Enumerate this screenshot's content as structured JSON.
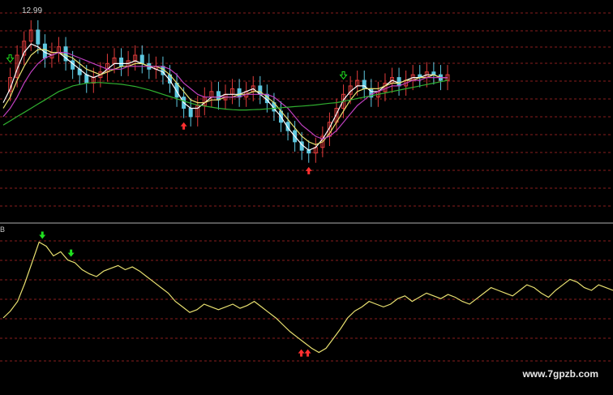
{
  "chart": {
    "price_label": "12.99",
    "sub_indicator_label": "B",
    "watermark": "www.7gpzb.com"
  },
  "colors": {
    "background": "#000000",
    "grid": "#8a1e1e",
    "divider": "#b0b0b0",
    "up_candle": "#e23c3c",
    "down_candle": "#5ec8e0",
    "ma_white": "#ffffff",
    "ma_yellow": "#e8e070",
    "ma_magenta": "#c040c0",
    "ma_green": "#30b030",
    "indicator_line": "#e8e070",
    "buy_arrow": "#ff3030",
    "sell_arrow": "#20e020"
  },
  "chart_data": [
    {
      "type": "candlestick",
      "title": "",
      "ylim": [
        7.0,
        13.5
      ],
      "close": [
        10.4,
        10.9,
        11.7,
        12.2,
        12.6,
        12.1,
        11.6,
        11.8,
        12.0,
        11.5,
        11.2,
        11.0,
        10.7,
        10.9,
        11.1,
        11.4,
        11.6,
        11.3,
        11.5,
        11.7,
        11.4,
        11.2,
        11.3,
        11.0,
        10.7,
        10.2,
        9.8,
        9.5,
        9.9,
        10.2,
        10.4,
        10.1,
        10.3,
        10.5,
        10.2,
        10.4,
        10.6,
        10.3,
        10.0,
        9.7,
        9.3,
        9.0,
        8.6,
        8.3,
        8.2,
        8.4,
        8.8,
        9.3,
        9.8,
        10.3,
        10.6,
        10.8,
        10.5,
        10.2,
        10.4,
        10.7,
        10.9,
        10.6,
        10.8,
        11.0,
        10.9,
        11.1,
        11.0,
        10.8,
        11.0
      ],
      "series": [
        {
          "name": "",
          "values": [
            10.0,
            10.5,
            11.2,
            11.8,
            12.1,
            12.0,
            11.8,
            11.7,
            11.8,
            11.6,
            11.4,
            11.2,
            11.0,
            10.9,
            11.0,
            11.2,
            11.4,
            11.4,
            11.4,
            11.5,
            11.4,
            11.3,
            11.2,
            11.1,
            10.8,
            10.4,
            10.0,
            9.8,
            9.8,
            10.0,
            10.2,
            10.2,
            10.3,
            10.3,
            10.3,
            10.4,
            10.5,
            10.3,
            10.1,
            9.8,
            9.5,
            9.1,
            8.8,
            8.5,
            8.3,
            8.4,
            8.7,
            9.1,
            9.6,
            10.1,
            10.4,
            10.6,
            10.6,
            10.4,
            10.4,
            10.6,
            10.8,
            10.7,
            10.8,
            10.9,
            10.9,
            11.0,
            11.0,
            10.9,
            10.9
          ]
        },
        {
          "name": "",
          "values": [
            9.8,
            10.2,
            10.8,
            11.3,
            11.7,
            11.9,
            11.9,
            11.8,
            11.8,
            11.7,
            11.6,
            11.4,
            11.2,
            11.1,
            11.0,
            11.1,
            11.2,
            11.3,
            11.3,
            11.4,
            11.4,
            11.3,
            11.3,
            11.2,
            11.0,
            10.7,
            10.4,
            10.1,
            10.0,
            10.0,
            10.1,
            10.1,
            10.2,
            10.2,
            10.3,
            10.3,
            10.4,
            10.4,
            10.2,
            10.0,
            9.7,
            9.4,
            9.1,
            8.8,
            8.6,
            8.5,
            8.6,
            8.9,
            9.3,
            9.7,
            10.1,
            10.4,
            10.5,
            10.5,
            10.5,
            10.6,
            10.7,
            10.7,
            10.8,
            10.8,
            10.9,
            10.9,
            11.0,
            10.9,
            10.9
          ]
        },
        {
          "name": "",
          "values": [
            9.5,
            9.8,
            10.2,
            10.7,
            11.1,
            11.4,
            11.6,
            11.7,
            11.8,
            11.8,
            11.7,
            11.6,
            11.5,
            11.4,
            11.3,
            11.2,
            11.2,
            11.2,
            11.3,
            11.3,
            11.3,
            11.3,
            11.3,
            11.3,
            11.2,
            11.0,
            10.7,
            10.5,
            10.3,
            10.2,
            10.2,
            10.2,
            10.2,
            10.2,
            10.2,
            10.3,
            10.3,
            10.3,
            10.3,
            10.2,
            10.0,
            9.8,
            9.5,
            9.2,
            9.0,
            8.8,
            8.7,
            8.8,
            9.0,
            9.3,
            9.6,
            9.9,
            10.1,
            10.3,
            10.4,
            10.5,
            10.6,
            10.6,
            10.7,
            10.8,
            10.8,
            10.9,
            10.9,
            10.9,
            10.9
          ]
        },
        {
          "name": "",
          "values": [
            9.2,
            9.35,
            9.5,
            9.65,
            9.8,
            9.95,
            10.1,
            10.25,
            10.4,
            10.5,
            10.6,
            10.65,
            10.7,
            10.72,
            10.72,
            10.7,
            10.68,
            10.66,
            10.62,
            10.58,
            10.52,
            10.46,
            10.38,
            10.3,
            10.22,
            10.14,
            10.06,
            9.98,
            9.92,
            9.88,
            9.84,
            9.8,
            9.77,
            9.75,
            9.74,
            9.74,
            9.75,
            9.76,
            9.78,
            9.8,
            9.82,
            9.84,
            9.86,
            9.88,
            9.9,
            9.92,
            9.95,
            9.98,
            10.0,
            10.05,
            10.1,
            10.15,
            10.2,
            10.25,
            10.3,
            10.35,
            10.4,
            10.45,
            10.5,
            10.55,
            10.6,
            10.65,
            10.7,
            10.75,
            10.8
          ]
        }
      ],
      "buy_signals": [
        26,
        44
      ],
      "sell_signals": [
        1,
        49
      ]
    },
    {
      "type": "line",
      "title": "",
      "ylim": [
        0,
        100
      ],
      "values": [
        40,
        45,
        52,
        65,
        80,
        95,
        92,
        85,
        88,
        82,
        80,
        75,
        72,
        70,
        74,
        76,
        78,
        75,
        77,
        74,
        70,
        66,
        62,
        58,
        52,
        48,
        44,
        46,
        50,
        48,
        46,
        48,
        50,
        47,
        49,
        52,
        48,
        44,
        40,
        35,
        30,
        26,
        22,
        18,
        15,
        18,
        25,
        32,
        40,
        45,
        48,
        52,
        50,
        48,
        50,
        54,
        56,
        52,
        55,
        58,
        56,
        54,
        57,
        55,
        52,
        50,
        54,
        58,
        62,
        60,
        58,
        56,
        60,
        64,
        62,
        58,
        55,
        60,
        64,
        68,
        66,
        62,
        60,
        64,
        62,
        60
      ],
      "buy_signals": [
        42
      ],
      "sell_signals": [
        5,
        9
      ]
    }
  ]
}
